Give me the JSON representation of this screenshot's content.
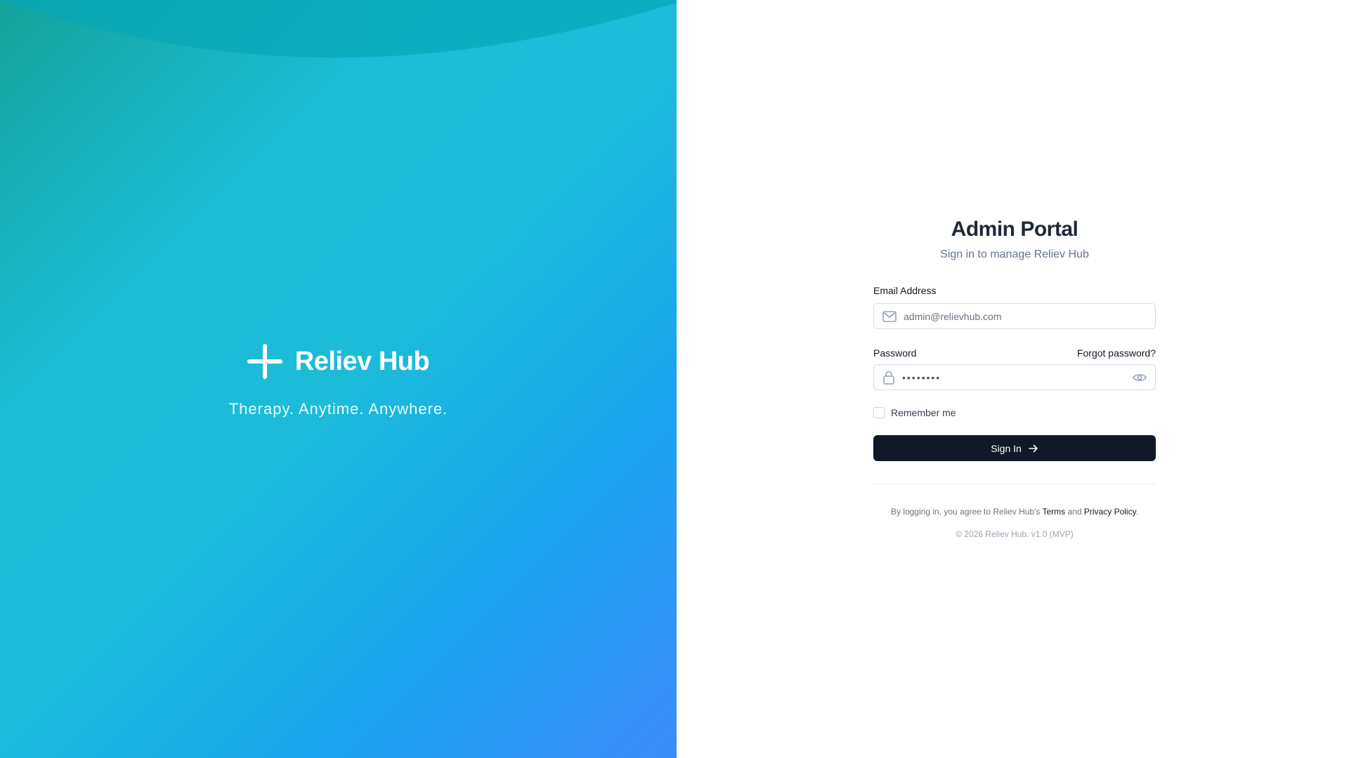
{
  "brand": {
    "name": "Reliev Hub",
    "tagline": "Therapy. Anytime. Anywhere."
  },
  "colors": {
    "gradient_start": "#14a39c",
    "gradient_mid": "#1cbcd9",
    "gradient_end": "#3b8cfb",
    "button_bg": "#111827",
    "title": "#1f2937"
  },
  "form": {
    "title": "Admin Portal",
    "subtitle": "Sign in to manage Reliev Hub",
    "email": {
      "label": "Email Address",
      "placeholder": "admin@relievhub.com",
      "icon": "mail-icon"
    },
    "password": {
      "label": "Password",
      "forgot_label": "Forgot password?",
      "masked_value": "••••••••",
      "icon": "lock-icon",
      "toggle_icon": "eye-icon"
    },
    "remember_label": "Remember me",
    "submit_label": "Sign In",
    "submit_icon": "arrow-right-icon"
  },
  "footer": {
    "legal_prefix": "By logging in, you agree to Reliev Hub's",
    "terms_label": "Terms",
    "and_label": "and",
    "privacy_label": "Privacy Policy",
    "period": ".",
    "copyright": "© 2026 Reliev Hub. v1.0 (MVP)"
  }
}
